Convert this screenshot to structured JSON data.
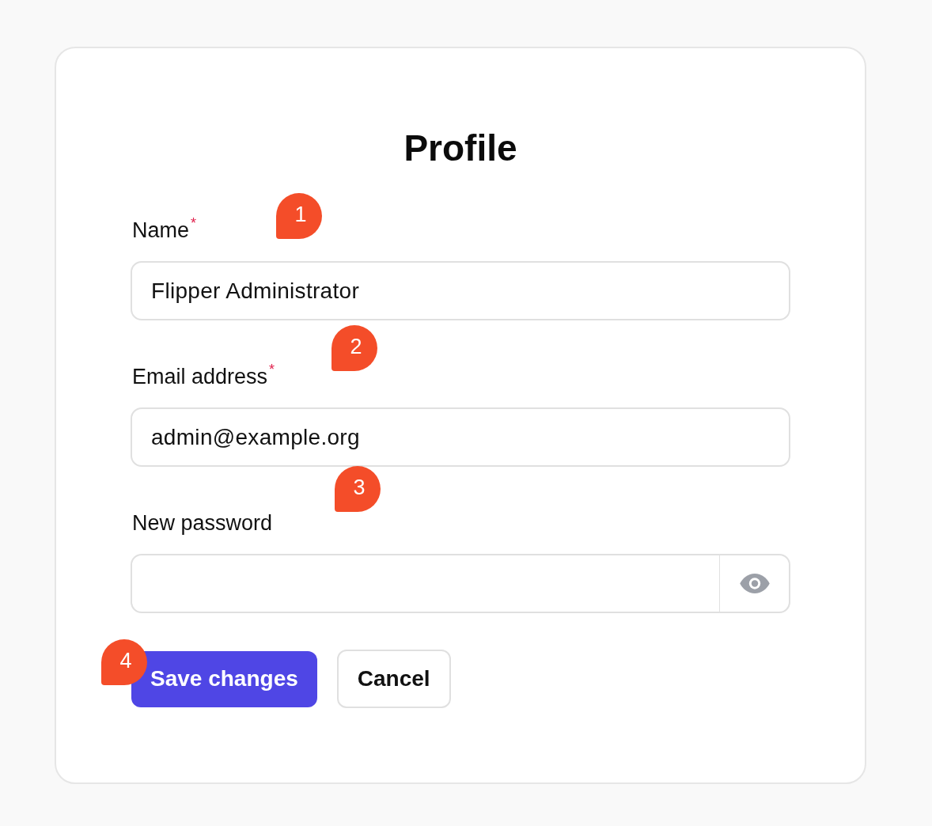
{
  "title": "Profile",
  "fields": [
    {
      "label": "Name",
      "required_mark": "*",
      "kind": "text",
      "value": "Flipper Administrator",
      "annotation": "1"
    },
    {
      "label": "Email address",
      "required_mark": "*",
      "kind": "text",
      "value": "admin@example.org",
      "annotation": "2"
    },
    {
      "label": "New password",
      "kind": "password",
      "annotation": "3"
    }
  ],
  "buttons": [
    {
      "label": "Save changes",
      "kind": "primary",
      "annotation": "4"
    },
    {
      "label": "Cancel",
      "kind": "secondary"
    }
  ]
}
